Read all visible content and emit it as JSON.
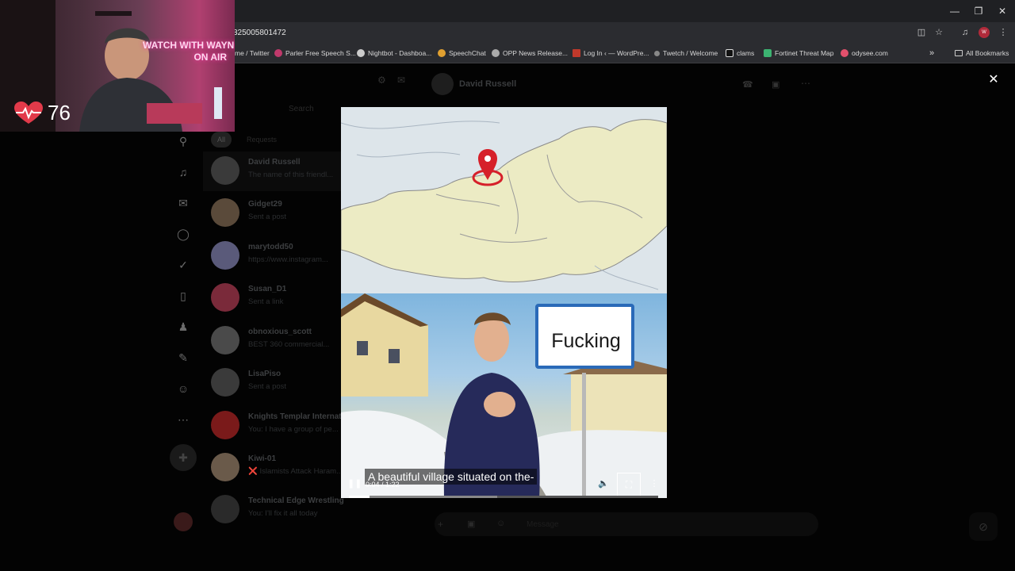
{
  "browser": {
    "url": "325005801472",
    "bookmarks": [
      {
        "label": "me / Twitter",
        "icon": "twitter-icon"
      },
      {
        "label": "Parler Free Speech S...",
        "icon": "parler-icon"
      },
      {
        "label": "Nightbot - Dashboa...",
        "icon": "nightbot-icon"
      },
      {
        "label": "SpeechChat",
        "icon": "speechchat-icon"
      },
      {
        "label": "OPP News Release...",
        "icon": "globe-icon"
      },
      {
        "label": "Log In ‹ — WordPre...",
        "icon": "wordpress-icon"
      },
      {
        "label": "Twetch / Welcome",
        "icon": "twetch-icon"
      },
      {
        "label": "clams",
        "icon": "amazon-icon"
      },
      {
        "label": "Fortinet Threat Map",
        "icon": "shield-icon"
      },
      {
        "label": "odysee.com",
        "icon": "odysee-icon"
      }
    ],
    "all_bookmarks": "All Bookmarks",
    "overflow": "»"
  },
  "app": {
    "conversation_title": "David Russell",
    "search_placeholder": "Search",
    "filters": [
      "All",
      "Requests"
    ],
    "message_placeholder": "Message",
    "conversations": [
      {
        "name": "David Russell",
        "preview": "The name of this friendl...",
        "verified": true,
        "color": "#3a3a3a"
      },
      {
        "name": "Gidget29",
        "preview": "Sent a post",
        "verified": false,
        "color": "#5a4a3a"
      },
      {
        "name": "marytodd50",
        "preview": "https://www.instagram...",
        "verified": true,
        "color": "#5a5a7a"
      },
      {
        "name": "Susan_D1",
        "preview": "Sent a link",
        "verified": true,
        "color": "#7a2a3a"
      },
      {
        "name": "obnoxious_scott",
        "preview": "BEST 360 commercial...",
        "verified": true,
        "color": "#4a4a4a"
      },
      {
        "name": "LisaPiso",
        "preview": "Sent a post",
        "verified": false,
        "color": "#3a3a3a"
      },
      {
        "name": "Knights Templar Internat...",
        "preview": "You: I have a group of pe...",
        "verified": false,
        "color": "#7a1a1a"
      },
      {
        "name": "Kiwi-01",
        "preview": "❌ Islamists Attack Haram...",
        "verified": false,
        "color": "#6a5a4a"
      },
      {
        "name": "Technical Edge Wrestling",
        "preview": "You: I'll fix it all today",
        "verified": false,
        "color": "#2a2a2a"
      }
    ]
  },
  "video": {
    "sign_text": "Fucking",
    "caption": "A beautiful village situated on the-",
    "time": "0:04 / 1:22",
    "progress": 0.066,
    "buffered": 0.48
  },
  "webcam": {
    "neon_line1": "WATCH WITH WAYNE",
    "neon_line2": "ON AIR",
    "bpm": "76"
  }
}
